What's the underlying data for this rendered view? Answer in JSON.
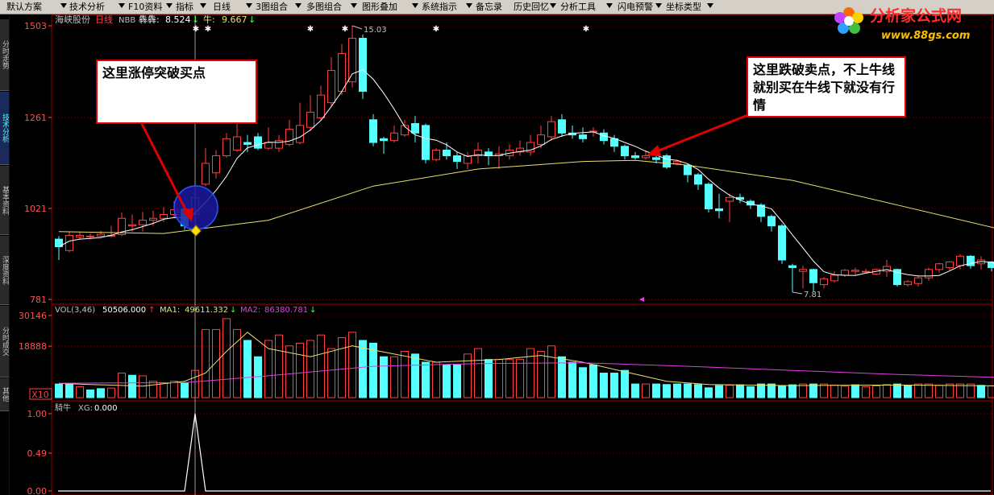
{
  "toolbar": {
    "items": [
      "默认方案",
      "技术分析",
      "F10资料",
      "指标",
      "日线",
      "3图组合",
      "多图组合",
      "图形叠加",
      "系统指示",
      "备忘录",
      "历史回忆",
      "分析工具",
      "闪电预警",
      "坐标类型"
    ]
  },
  "sidebar": {
    "tabs": [
      "分时走势",
      "技术分析",
      "基本资料",
      "深度资料",
      "分时成交",
      "其他"
    ],
    "active": 1
  },
  "logo": {
    "text": "分析家公式网",
    "url": "www.88gs.com"
  },
  "header": {
    "stock": "海峡股份",
    "period": "日线",
    "indicator": "NBB",
    "val1_label": "犇犇:",
    "val1": "8.524",
    "val2_label": "牛:",
    "val2": "9.667"
  },
  "vol_header": {
    "name": "VOL(3,46)",
    "value": "50506.000",
    "ma1_label": "MA1:",
    "ma1": "49611.332",
    "ma2_label": "MA2:",
    "ma2": "86380.781"
  },
  "ind_header": {
    "name": "騎牛",
    "label": "XG:",
    "value": "0.000"
  },
  "annotations": {
    "buy": "这里涨停突破买点",
    "sell": "这里跌破卖点，不上牛线就别买在牛线下就没有行情"
  },
  "colors": {
    "up": "#ff4040",
    "down": "#54ffff",
    "ma_short": "#ffffff",
    "ma_long": "#e8e070",
    "grid": "#800000",
    "axis_text": "#ff5050",
    "vol_ma1": "#e8e070",
    "vol_ma2": "#e040e0"
  },
  "chart_data": {
    "type": "candlestick",
    "price": {
      "ticks": [
        781,
        1021,
        1261,
        1503
      ],
      "ylim": [
        781,
        1503
      ],
      "high_label": "15.03",
      "low_label": "7.81",
      "candles": [
        {
          "o": 940,
          "c": 920,
          "h": 948,
          "l": 885
        },
        {
          "o": 910,
          "c": 950,
          "h": 960,
          "l": 905
        },
        {
          "o": 945,
          "c": 950,
          "h": 958,
          "l": 940
        },
        {
          "o": 948,
          "c": 948,
          "h": 955,
          "l": 940
        },
        {
          "o": 948,
          "c": 953,
          "h": 962,
          "l": 944
        },
        {
          "o": 950,
          "c": 950,
          "h": 975,
          "l": 944
        },
        {
          "o": 952,
          "c": 995,
          "h": 1010,
          "l": 948
        },
        {
          "o": 975,
          "c": 978,
          "h": 1005,
          "l": 960
        },
        {
          "o": 978,
          "c": 990,
          "h": 1012,
          "l": 960
        },
        {
          "o": 990,
          "c": 995,
          "h": 1015,
          "l": 975
        },
        {
          "o": 995,
          "c": 1005,
          "h": 1025,
          "l": 985
        },
        {
          "o": 1005,
          "c": 1018,
          "h": 1040,
          "l": 995
        },
        {
          "o": 1020,
          "c": 975,
          "h": 1030,
          "l": 965
        },
        {
          "o": 1005,
          "c": 1050,
          "h": 1050,
          "l": 1000
        },
        {
          "o": 1085,
          "c": 1140,
          "h": 1180,
          "l": 1080
        },
        {
          "o": 1115,
          "c": 1160,
          "h": 1175,
          "l": 1100
        },
        {
          "o": 1160,
          "c": 1205,
          "h": 1220,
          "l": 1155
        },
        {
          "o": 1175,
          "c": 1210,
          "h": 1250,
          "l": 1170
        },
        {
          "o": 1195,
          "c": 1190,
          "h": 1215,
          "l": 1170
        },
        {
          "o": 1210,
          "c": 1180,
          "h": 1220,
          "l": 1175
        },
        {
          "o": 1180,
          "c": 1195,
          "h": 1235,
          "l": 1175
        },
        {
          "o": 1180,
          "c": 1200,
          "h": 1215,
          "l": 1170
        },
        {
          "o": 1190,
          "c": 1230,
          "h": 1255,
          "l": 1185
        },
        {
          "o": 1195,
          "c": 1240,
          "h": 1300,
          "l": 1190
        },
        {
          "o": 1235,
          "c": 1275,
          "h": 1320,
          "l": 1225
        },
        {
          "o": 1260,
          "c": 1320,
          "h": 1345,
          "l": 1255
        },
        {
          "o": 1300,
          "c": 1385,
          "h": 1420,
          "l": 1290
        },
        {
          "o": 1330,
          "c": 1430,
          "h": 1455,
          "l": 1320
        },
        {
          "o": 1355,
          "c": 1470,
          "h": 1503,
          "l": 1340
        },
        {
          "o": 1470,
          "c": 1330,
          "h": 1480,
          "l": 1310
        },
        {
          "o": 1255,
          "c": 1195,
          "h": 1270,
          "l": 1185
        },
        {
          "o": 1205,
          "c": 1200,
          "h": 1210,
          "l": 1165
        },
        {
          "o": 1200,
          "c": 1220,
          "h": 1240,
          "l": 1195
        },
        {
          "o": 1215,
          "c": 1240,
          "h": 1255,
          "l": 1210
        },
        {
          "o": 1245,
          "c": 1220,
          "h": 1265,
          "l": 1195
        },
        {
          "o": 1240,
          "c": 1150,
          "h": 1245,
          "l": 1140
        },
        {
          "o": 1150,
          "c": 1175,
          "h": 1180,
          "l": 1145
        },
        {
          "o": 1175,
          "c": 1160,
          "h": 1195,
          "l": 1150
        },
        {
          "o": 1160,
          "c": 1145,
          "h": 1170,
          "l": 1125
        },
        {
          "o": 1140,
          "c": 1160,
          "h": 1170,
          "l": 1125
        },
        {
          "o": 1160,
          "c": 1175,
          "h": 1195,
          "l": 1140
        },
        {
          "o": 1170,
          "c": 1160,
          "h": 1180,
          "l": 1135
        },
        {
          "o": 1160,
          "c": 1165,
          "h": 1185,
          "l": 1125
        },
        {
          "o": 1160,
          "c": 1175,
          "h": 1190,
          "l": 1150
        },
        {
          "o": 1170,
          "c": 1180,
          "h": 1200,
          "l": 1160
        },
        {
          "o": 1170,
          "c": 1195,
          "h": 1215,
          "l": 1160
        },
        {
          "o": 1190,
          "c": 1215,
          "h": 1240,
          "l": 1180
        },
        {
          "o": 1210,
          "c": 1250,
          "h": 1265,
          "l": 1200
        },
        {
          "o": 1255,
          "c": 1220,
          "h": 1270,
          "l": 1210
        },
        {
          "o": 1220,
          "c": 1215,
          "h": 1240,
          "l": 1205
        },
        {
          "o": 1215,
          "c": 1205,
          "h": 1235,
          "l": 1195
        },
        {
          "o": 1225,
          "c": 1225,
          "h": 1235,
          "l": 1210
        },
        {
          "o": 1220,
          "c": 1200,
          "h": 1230,
          "l": 1190
        },
        {
          "o": 1205,
          "c": 1185,
          "h": 1215,
          "l": 1170
        },
        {
          "o": 1185,
          "c": 1160,
          "h": 1190,
          "l": 1150
        },
        {
          "o": 1160,
          "c": 1155,
          "h": 1170,
          "l": 1150
        },
        {
          "o": 1155,
          "c": 1160,
          "h": 1175,
          "l": 1150
        },
        {
          "o": 1155,
          "c": 1150,
          "h": 1165,
          "l": 1140
        },
        {
          "o": 1160,
          "c": 1130,
          "h": 1165,
          "l": 1125
        },
        {
          "o": 1140,
          "c": 1145,
          "h": 1150,
          "l": 1135
        },
        {
          "o": 1135,
          "c": 1110,
          "h": 1140,
          "l": 1090
        },
        {
          "o": 1110,
          "c": 1085,
          "h": 1115,
          "l": 1070
        },
        {
          "o": 1085,
          "c": 1020,
          "h": 1090,
          "l": 1010
        },
        {
          "o": 1020,
          "c": 1015,
          "h": 1060,
          "l": 995
        },
        {
          "o": 1040,
          "c": 1050,
          "h": 1060,
          "l": 985
        },
        {
          "o": 1050,
          "c": 1045,
          "h": 1060,
          "l": 1035
        },
        {
          "o": 1040,
          "c": 1030,
          "h": 1045,
          "l": 1020
        },
        {
          "o": 1030,
          "c": 1000,
          "h": 1035,
          "l": 985
        },
        {
          "o": 1000,
          "c": 975,
          "h": 1005,
          "l": 960
        },
        {
          "o": 975,
          "c": 885,
          "h": 980,
          "l": 875
        },
        {
          "o": 870,
          "c": 865,
          "h": 875,
          "l": 800
        },
        {
          "o": 855,
          "c": 860,
          "h": 870,
          "l": 810
        },
        {
          "o": 860,
          "c": 825,
          "h": 862,
          "l": 800
        },
        {
          "o": 820,
          "c": 835,
          "h": 840,
          "l": 810
        },
        {
          "o": 830,
          "c": 845,
          "h": 855,
          "l": 825
        },
        {
          "o": 845,
          "c": 858,
          "h": 862,
          "l": 840
        },
        {
          "o": 855,
          "c": 858,
          "h": 865,
          "l": 845
        },
        {
          "o": 855,
          "c": 855,
          "h": 862,
          "l": 850
        },
        {
          "o": 848,
          "c": 860,
          "h": 862,
          "l": 845
        },
        {
          "o": 855,
          "c": 868,
          "h": 885,
          "l": 840
        },
        {
          "o": 860,
          "c": 820,
          "h": 862,
          "l": 815
        },
        {
          "o": 820,
          "c": 828,
          "h": 832,
          "l": 815
        },
        {
          "o": 823,
          "c": 838,
          "h": 842,
          "l": 815
        },
        {
          "o": 838,
          "c": 860,
          "h": 865,
          "l": 830
        },
        {
          "o": 860,
          "c": 875,
          "h": 878,
          "l": 852
        },
        {
          "o": 865,
          "c": 880,
          "h": 882,
          "l": 858
        },
        {
          "o": 870,
          "c": 895,
          "h": 900,
          "l": 860
        },
        {
          "o": 895,
          "c": 870,
          "h": 898,
          "l": 862
        },
        {
          "o": 875,
          "c": 885,
          "h": 895,
          "l": 860
        },
        {
          "o": 880,
          "c": 865,
          "h": 882,
          "l": 855
        },
        {
          "o": 870,
          "c": 830,
          "h": 875,
          "l": 825
        }
      ],
      "ma_long": [
        [
          0,
          960
        ],
        [
          10,
          955
        ],
        [
          20,
          990
        ],
        [
          30,
          1080
        ],
        [
          40,
          1125
        ],
        [
          50,
          1145
        ],
        [
          55,
          1148
        ],
        [
          60,
          1135
        ],
        [
          70,
          1095
        ],
        [
          80,
          1030
        ],
        [
          90,
          965
        ],
        [
          90.8,
          962
        ]
      ]
    },
    "volume": {
      "ticks": [
        18888,
        30146
      ],
      "ylim": [
        0,
        30146
      ],
      "unit_label": "X10",
      "up": [
        0,
        0,
        1,
        0,
        0,
        1,
        1,
        0,
        1,
        1,
        1,
        1,
        0,
        1,
        1,
        1,
        1,
        1,
        0,
        0,
        1,
        1,
        1,
        1,
        1,
        1,
        1,
        1,
        1,
        0,
        0,
        0,
        1,
        1,
        0,
        0,
        1,
        0,
        0,
        1,
        1,
        0,
        1,
        1,
        1,
        1,
        1,
        1,
        0,
        0,
        0,
        0,
        0,
        0,
        0,
        0,
        1,
        0,
        0,
        0,
        0,
        0,
        0,
        0,
        1,
        0,
        0,
        0,
        0,
        0,
        0,
        1,
        0,
        1,
        1,
        1,
        0,
        1,
        1,
        1,
        0,
        0,
        1,
        1,
        1,
        1,
        1,
        1,
        0,
        1,
        0,
        0
      ],
      "values": [
        5000,
        5200,
        4000,
        2800,
        3300,
        3500,
        9000,
        8200,
        8000,
        6000,
        5400,
        6000,
        5500,
        10000,
        25000,
        25000,
        29000,
        25000,
        21000,
        15000,
        21000,
        23000,
        19000,
        20000,
        21000,
        23000,
        18000,
        22000,
        24000,
        21000,
        20000,
        15000,
        15000,
        17000,
        16000,
        13000,
        13000,
        12000,
        12000,
        16000,
        18000,
        14000,
        14000,
        14000,
        14000,
        18000,
        17000,
        19000,
        15000,
        13000,
        11000,
        12000,
        9000,
        9000,
        10000,
        5000,
        5000,
        5000,
        4800,
        5000,
        5000,
        4800,
        3600,
        4400,
        4500,
        4700,
        4000,
        5000,
        5000,
        4300,
        4700,
        5000,
        5000,
        5000,
        4600,
        4200,
        4700,
        4000,
        4300,
        4800,
        5000,
        4400,
        5000,
        5000,
        4500,
        5000,
        5000,
        5000,
        4500,
        4300,
        3800,
        4000
      ],
      "ma1": [
        [
          0,
          5200
        ],
        [
          8,
          4200
        ],
        [
          12,
          6000
        ],
        [
          14,
          9000
        ],
        [
          16,
          17000
        ],
        [
          18,
          24000
        ],
        [
          20,
          18000
        ],
        [
          24,
          15000
        ],
        [
          28,
          19000
        ],
        [
          32,
          16000
        ],
        [
          36,
          13000
        ],
        [
          42,
          14000
        ],
        [
          46,
          15500
        ],
        [
          50,
          13000
        ],
        [
          54,
          9500
        ],
        [
          58,
          6000
        ],
        [
          62,
          4800
        ],
        [
          70,
          4400
        ],
        [
          80,
          4600
        ],
        [
          90,
          4300
        ],
        [
          92,
          4200
        ]
      ],
      "ma2": [
        [
          0,
          5300
        ],
        [
          12,
          5500
        ],
        [
          20,
          8000
        ],
        [
          30,
          11500
        ],
        [
          40,
          12500
        ],
        [
          50,
          12800
        ],
        [
          60,
          11500
        ],
        [
          70,
          10000
        ],
        [
          80,
          8500
        ],
        [
          90,
          7400
        ],
        [
          92,
          7200
        ]
      ]
    },
    "signal": {
      "ticks": [
        0,
        0.49,
        1.0
      ],
      "ylim": [
        0,
        1.0
      ],
      "spike_index": 13
    }
  }
}
